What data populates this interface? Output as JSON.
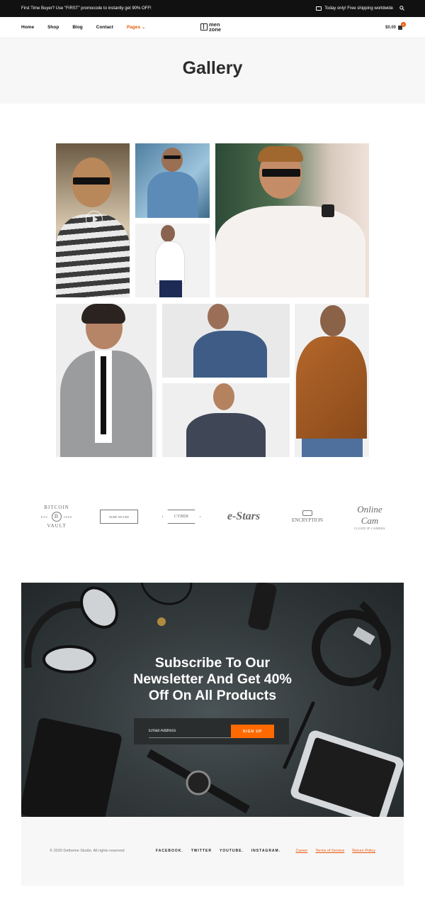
{
  "topbar": {
    "promo": "First Time Buyer? Use \"FIRST\" promocode to instantly get 90% OFF!",
    "shipping": "Today only! Free shipping worldwide"
  },
  "nav": {
    "items": [
      {
        "label": "Home"
      },
      {
        "label": "Shop"
      },
      {
        "label": "Blog"
      },
      {
        "label": "Contact"
      },
      {
        "label": "Pages"
      }
    ],
    "logo_line1": "men",
    "logo_line2": "zone",
    "cart_total": "$0.00",
    "cart_count": "0"
  },
  "page": {
    "title": "Gallery"
  },
  "brands": {
    "bitcoin_top": "BITCOIN",
    "bitcoin_left": "EST.",
    "bitcoin_coin": "B",
    "bitcoin_right": "2009",
    "bitcoin_bottom": "VAULT",
    "home_secure": "HOME SECURE",
    "cyber": "CYBER",
    "estars": "e-Stars",
    "encryption": "ENCRYPTION",
    "online_cam": "Online Cam",
    "online_cam_sub": "CLOUD IP CAMERA"
  },
  "newsletter": {
    "title_line1": "Subscribe To Our",
    "title_line2": "Newsletter And Get 40%",
    "title_line3": "Off On All Products",
    "email_placeholder": "Email Address",
    "button_label": "SIGN UP"
  },
  "footer": {
    "copyright": "© 2020 Dethemе Studio. All rights reserved",
    "social": [
      "FACEBOOK.",
      "TWITTER",
      "YOUTUBE.",
      "INSTAGRAM."
    ],
    "links": [
      "Career",
      "Terms of Service",
      "Return Policy"
    ]
  },
  "colors": {
    "accent": "#e8590c",
    "button": "#ff6a00",
    "topbar": "#111111"
  }
}
